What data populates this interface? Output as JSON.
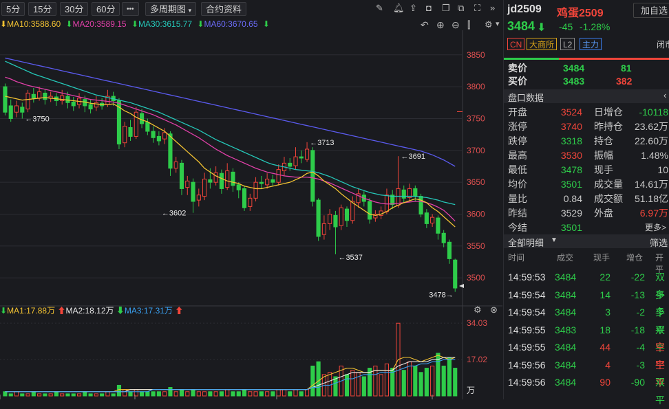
{
  "toolbar": {
    "periods": [
      "5分",
      "15分",
      "30分",
      "60分"
    ],
    "more": "•••",
    "multi_period": "多周期图",
    "contract_info": "合约资料"
  },
  "ma_line": {
    "ma10": "MA10:3588.60",
    "ma20": "MA20:3589.15",
    "ma30": "MA30:3615.77",
    "ma60": "MA60:3670.65"
  },
  "vol_line": {
    "ma1": "MA1:17.88万",
    "ma2": "MA2:18.12万",
    "ma3": "MA3:17.31万"
  },
  "colors": {
    "ma10": "#f2c232",
    "ma20": "#e040a8",
    "ma30": "#25c7b8",
    "ma60": "#5b5bf0",
    "up": "#f0453a",
    "down": "#2ecc4a"
  },
  "chart_data": {
    "type": "candlestick",
    "ylim": [
      3470,
      3880
    ],
    "y_ticks": [
      3850,
      3800,
      3750,
      3700,
      3650,
      3600,
      3550,
      3500
    ],
    "annotations": [
      {
        "label": "3750",
        "index": 3,
        "value": 3750
      },
      {
        "label": "3602",
        "index": 27,
        "value": 3602
      },
      {
        "label": "3713",
        "index": 53,
        "value": 3713
      },
      {
        "label": "3537",
        "index": 58,
        "value": 3537
      },
      {
        "label": "3691",
        "index": 69,
        "value": 3691
      },
      {
        "label": "3478",
        "index": 79,
        "value": 3478
      }
    ],
    "candles": [
      [
        3800,
        3760,
        3805,
        3755
      ],
      [
        3770,
        3750,
        3780,
        3745
      ],
      [
        3760,
        3770,
        3778,
        3752
      ],
      [
        3768,
        3760,
        3775,
        3750
      ],
      [
        3765,
        3790,
        3795,
        3760
      ],
      [
        3788,
        3782,
        3798,
        3775
      ],
      [
        3782,
        3792,
        3800,
        3778
      ],
      [
        3790,
        3780,
        3796,
        3772
      ],
      [
        3782,
        3785,
        3792,
        3776
      ],
      [
        3784,
        3778,
        3790,
        3770
      ],
      [
        3778,
        3786,
        3795,
        3772
      ],
      [
        3785,
        3775,
        3792,
        3766
      ],
      [
        3776,
        3770,
        3784,
        3762
      ],
      [
        3772,
        3782,
        3790,
        3766
      ],
      [
        3780,
        3770,
        3786,
        3760
      ],
      [
        3772,
        3765,
        3780,
        3758
      ],
      [
        3768,
        3775,
        3785,
        3762
      ],
      [
        3774,
        3770,
        3782,
        3764
      ],
      [
        3772,
        3785,
        3795,
        3768
      ],
      [
        3785,
        3778,
        3792,
        3770
      ],
      [
        3778,
        3710,
        3782,
        3702
      ],
      [
        3712,
        3738,
        3745,
        3705
      ],
      [
        3736,
        3722,
        3748,
        3715
      ],
      [
        3722,
        3760,
        3768,
        3718
      ],
      [
        3758,
        3742,
        3765,
        3735
      ],
      [
        3744,
        3730,
        3750,
        3724
      ],
      [
        3730,
        3720,
        3738,
        3712
      ],
      [
        3722,
        3715,
        3730,
        3708
      ],
      [
        3718,
        3728,
        3735,
        3710
      ],
      [
        3726,
        3672,
        3730,
        3660
      ],
      [
        3672,
        3682,
        3690,
        3665
      ],
      [
        3680,
        3640,
        3685,
        3630
      ],
      [
        3642,
        3652,
        3660,
        3630
      ],
      [
        3650,
        3620,
        3656,
        3602
      ],
      [
        3622,
        3630,
        3640,
        3612
      ],
      [
        3628,
        3655,
        3665,
        3622
      ],
      [
        3654,
        3650,
        3672,
        3640
      ],
      [
        3650,
        3665,
        3675,
        3645
      ],
      [
        3664,
        3640,
        3670,
        3632
      ],
      [
        3642,
        3668,
        3680,
        3638
      ],
      [
        3666,
        3645,
        3672,
        3635
      ],
      [
        3646,
        3638,
        3650,
        3625
      ],
      [
        3640,
        3610,
        3645,
        3605
      ],
      [
        3612,
        3625,
        3632,
        3605
      ],
      [
        3625,
        3650,
        3658,
        3620
      ],
      [
        3650,
        3648,
        3660,
        3640
      ],
      [
        3646,
        3655,
        3664,
        3640
      ],
      [
        3654,
        3650,
        3662,
        3644
      ],
      [
        3650,
        3670,
        3678,
        3645
      ],
      [
        3668,
        3680,
        3690,
        3660
      ],
      [
        3680,
        3675,
        3688,
        3668
      ],
      [
        3676,
        3690,
        3705,
        3670
      ],
      [
        3690,
        3688,
        3700,
        3680
      ],
      [
        3686,
        3702,
        3713,
        3682
      ],
      [
        3700,
        3620,
        3705,
        3612
      ],
      [
        3622,
        3565,
        3625,
        3558
      ],
      [
        3568,
        3585,
        3598,
        3560
      ],
      [
        3585,
        3600,
        3608,
        3575
      ],
      [
        3598,
        3580,
        3605,
        3537
      ],
      [
        3582,
        3610,
        3615,
        3575
      ],
      [
        3608,
        3590,
        3612,
        3580
      ],
      [
        3590,
        3620,
        3628,
        3585
      ],
      [
        3618,
        3632,
        3640,
        3610
      ],
      [
        3630,
        3620,
        3636,
        3612
      ],
      [
        3620,
        3592,
        3625,
        3585
      ],
      [
        3594,
        3600,
        3606,
        3588
      ],
      [
        3598,
        3605,
        3612,
        3592
      ],
      [
        3604,
        3630,
        3640,
        3600
      ],
      [
        3630,
        3615,
        3638,
        3608
      ],
      [
        3614,
        3640,
        3691,
        3610
      ],
      [
        3638,
        3625,
        3645,
        3618
      ],
      [
        3626,
        3640,
        3648,
        3620
      ],
      [
        3640,
        3628,
        3645,
        3620
      ],
      [
        3628,
        3600,
        3632,
        3595
      ],
      [
        3602,
        3585,
        3608,
        3578
      ],
      [
        3586,
        3595,
        3600,
        3580
      ],
      [
        3594,
        3570,
        3598,
        3560
      ],
      [
        3570,
        3555,
        3575,
        3548
      ],
      [
        3556,
        3530,
        3560,
        3522
      ],
      [
        3528,
        3484,
        3530,
        3478
      ]
    ],
    "ma10": [
      3785,
      3783,
      3781,
      3779,
      3780,
      3781,
      3782,
      3783,
      3782,
      3781,
      3780,
      3779,
      3778,
      3777,
      3776,
      3774,
      3773,
      3772,
      3772,
      3773,
      3768,
      3762,
      3758,
      3752,
      3748,
      3745,
      3740,
      3735,
      3730,
      3722,
      3714,
      3706,
      3698,
      3690,
      3682,
      3672,
      3666,
      3660,
      3656,
      3652,
      3650,
      3648,
      3644,
      3642,
      3640,
      3640,
      3642,
      3644,
      3646,
      3648,
      3650,
      3654,
      3658,
      3664,
      3666,
      3660,
      3652,
      3646,
      3640,
      3632,
      3625,
      3618,
      3612,
      3606,
      3600,
      3598,
      3600,
      3604,
      3610,
      3614,
      3618,
      3621,
      3624,
      3622,
      3618,
      3610,
      3604,
      3596,
      3588,
      3580
    ],
    "ma20": [
      3815,
      3812,
      3808,
      3805,
      3802,
      3800,
      3798,
      3796,
      3794,
      3792,
      3790,
      3788,
      3786,
      3784,
      3782,
      3780,
      3779,
      3778,
      3777,
      3776,
      3774,
      3771,
      3768,
      3765,
      3762,
      3759,
      3756,
      3752,
      3748,
      3744,
      3740,
      3735,
      3730,
      3725,
      3720,
      3714,
      3708,
      3702,
      3697,
      3692,
      3688,
      3684,
      3680,
      3676,
      3672,
      3669,
      3666,
      3664,
      3662,
      3660,
      3659,
      3658,
      3658,
      3658,
      3657,
      3655,
      3652,
      3649,
      3645,
      3641,
      3637,
      3633,
      3629,
      3625,
      3622,
      3619,
      3617,
      3616,
      3616,
      3617,
      3618,
      3619,
      3620,
      3620,
      3618,
      3615,
      3611,
      3606,
      3598,
      3589
    ],
    "ma30": [
      3840,
      3836,
      3832,
      3828,
      3824,
      3820,
      3817,
      3814,
      3811,
      3808,
      3805,
      3802,
      3799,
      3796,
      3793,
      3790,
      3787,
      3785,
      3783,
      3781,
      3779,
      3777,
      3775,
      3772,
      3769,
      3766,
      3763,
      3760,
      3756,
      3752,
      3748,
      3744,
      3740,
      3736,
      3732,
      3727,
      3722,
      3717,
      3713,
      3709,
      3705,
      3701,
      3697,
      3693,
      3689,
      3685,
      3681,
      3678,
      3676,
      3674,
      3672,
      3670,
      3669,
      3668,
      3667,
      3665,
      3662,
      3659,
      3655,
      3651,
      3647,
      3643,
      3640,
      3637,
      3634,
      3632,
      3630,
      3629,
      3628,
      3628,
      3628,
      3628,
      3628,
      3627,
      3626,
      3624,
      3622,
      3619,
      3617,
      3615
    ],
    "ma60": [
      3845,
      3843,
      3841,
      3839,
      3837,
      3835,
      3833,
      3831,
      3829,
      3827,
      3825,
      3823,
      3821,
      3819,
      3817,
      3815,
      3813,
      3811,
      3809,
      3807,
      3805,
      3803,
      3801,
      3799,
      3797,
      3795,
      3793,
      3791,
      3789,
      3787,
      3785,
      3783,
      3781,
      3779,
      3777,
      3775,
      3773,
      3771,
      3769,
      3767,
      3765,
      3763,
      3761,
      3759,
      3757,
      3755,
      3753,
      3751,
      3749,
      3747,
      3745,
      3743,
      3741,
      3739,
      3737,
      3735,
      3733,
      3731,
      3729,
      3727,
      3725,
      3723,
      3721,
      3719,
      3717,
      3715,
      3713,
      3711,
      3709,
      3707,
      3705,
      3703,
      3701,
      3699,
      3696,
      3693,
      3689,
      3685,
      3680,
      3675
    ],
    "volume": {
      "ylim": [
        0,
        36
      ],
      "y_ticks": [
        "34.03",
        "17.02"
      ],
      "unit": "万",
      "values": [
        2,
        1,
        2,
        1,
        1,
        2,
        1,
        1,
        1,
        2,
        1,
        1,
        1,
        1,
        2,
        1,
        1,
        1,
        2,
        1,
        5,
        3,
        2,
        3,
        2,
        2,
        2,
        2,
        2,
        4,
        2,
        3,
        2,
        3,
        2,
        2,
        2,
        2,
        2,
        3,
        2,
        2,
        3,
        2,
        2,
        2,
        2,
        2,
        3,
        3,
        2,
        3,
        2,
        3,
        14,
        16,
        10,
        11,
        9,
        14,
        10,
        12,
        11,
        9,
        13,
        14,
        10,
        15,
        13,
        34,
        12,
        16,
        14,
        11,
        13,
        14,
        20,
        14,
        18,
        13
      ],
      "ma1": [
        2,
        2,
        2,
        2,
        2,
        2,
        2,
        2,
        2,
        2,
        2,
        2,
        2,
        2,
        2,
        2,
        2,
        2,
        2,
        2,
        3,
        3,
        3,
        3,
        3,
        3,
        3,
        3,
        3,
        3,
        3,
        3,
        3,
        3,
        3,
        3,
        3,
        3,
        3,
        3,
        3,
        3,
        3,
        3,
        3,
        3,
        3,
        3,
        3,
        3,
        3,
        3,
        3,
        3,
        5,
        7,
        9,
        10,
        11,
        12,
        13,
        13,
        12,
        11,
        11,
        12,
        12,
        12,
        12,
        17,
        18,
        18,
        17,
        16,
        17,
        18,
        19,
        18,
        17,
        18
      ],
      "ma2": [
        2,
        2,
        2,
        2,
        2,
        2,
        2,
        2,
        2,
        2,
        2,
        2,
        2,
        2,
        2,
        2,
        2,
        2,
        2,
        2,
        2,
        2,
        3,
        3,
        3,
        3,
        3,
        3,
        3,
        3,
        3,
        3,
        3,
        3,
        3,
        3,
        3,
        3,
        3,
        3,
        3,
        3,
        3,
        3,
        3,
        3,
        3,
        3,
        3,
        3,
        3,
        3,
        3,
        3,
        4,
        5,
        6,
        7,
        8,
        9,
        10,
        11,
        11,
        11,
        11,
        12,
        12,
        12,
        12,
        14,
        15,
        16,
        16,
        16,
        16,
        17,
        17,
        18,
        18,
        18
      ],
      "ma3": [
        2,
        2,
        2,
        2,
        2,
        2,
        2,
        2,
        2,
        2,
        2,
        2,
        2,
        2,
        2,
        2,
        2,
        2,
        2,
        2,
        2,
        2,
        2,
        2,
        2,
        2,
        3,
        3,
        3,
        3,
        3,
        3,
        3,
        3,
        3,
        3,
        3,
        3,
        3,
        3,
        3,
        3,
        3,
        3,
        3,
        3,
        3,
        3,
        3,
        3,
        3,
        3,
        3,
        3,
        4,
        4,
        5,
        5,
        6,
        7,
        8,
        8,
        9,
        10,
        10,
        10,
        11,
        11,
        11,
        12,
        13,
        14,
        14,
        15,
        15,
        16,
        16,
        17,
        17,
        17
      ]
    }
  },
  "quote": {
    "code": "jd2509",
    "name": "鸡蛋2509",
    "add_button": "加自选",
    "price": "3484",
    "change": "-45",
    "change_pct": "-1.28%",
    "badges": [
      "CN",
      "大商所",
      "L2",
      "主力"
    ],
    "status": "闭市",
    "ask_label": "卖价",
    "ask_price": "3484",
    "ask_vol": "81",
    "bid_label": "买价",
    "bid_price": "3483",
    "bid_vol": "382",
    "panel_title": "盘口数据",
    "stats": [
      {
        "l1": "开盘",
        "v1": "3524",
        "c1": "red",
        "l2": "日增仓",
        "v2": "-10118",
        "c2": "grn"
      },
      {
        "l1": "涨停",
        "v1": "3740",
        "c1": "red",
        "l2": "昨持仓",
        "v2": "23.62万",
        "c2": "gry"
      },
      {
        "l1": "跌停",
        "v1": "3318",
        "c1": "grn",
        "l2": "持仓",
        "v2": "22.60万",
        "c2": "gry"
      },
      {
        "l1": "最高",
        "v1": "3530",
        "c1": "red",
        "l2": "振幅",
        "v2": "1.48%",
        "c2": "gry"
      },
      {
        "l1": "最低",
        "v1": "3478",
        "c1": "grn",
        "l2": "现手",
        "v2": "10",
        "c2": "gry"
      },
      {
        "l1": "均价",
        "v1": "3501",
        "c1": "grn",
        "l2": "成交量",
        "v2": "14.61万",
        "c2": "gry"
      },
      {
        "l1": "量比",
        "v1": "0.84",
        "c1": "gry",
        "l2": "成交额",
        "v2": "51.18亿",
        "c2": "gry"
      },
      {
        "l1": "昨结",
        "v1": "3529",
        "c1": "gry",
        "l2": "外盘",
        "v2": "6.97万",
        "c2": "red"
      },
      {
        "l1": "今结",
        "v1": "3501",
        "c1": "grn",
        "l2": "更多>",
        "v2": "",
        "c2": "gry"
      }
    ],
    "detail_title": "全部明细",
    "filter": "筛选",
    "trade_headers": [
      "时间",
      "成交",
      "现手",
      "增仓",
      "开平"
    ],
    "trades": [
      {
        "t": "14:59:53",
        "p": "3484",
        "v": "22",
        "vc": "grn",
        "d": "-22",
        "k": "双平",
        "kc": "grn"
      },
      {
        "t": "14:59:54",
        "p": "3484",
        "v": "14",
        "vc": "grn",
        "d": "-13",
        "k": "多平",
        "kc": "grn"
      },
      {
        "t": "14:59:54",
        "p": "3484",
        "v": "3",
        "vc": "grn",
        "d": "-2",
        "k": "多平",
        "kc": "grn"
      },
      {
        "t": "14:59:55",
        "p": "3483",
        "v": "18",
        "vc": "grn",
        "d": "-18",
        "k": "双平",
        "kc": "grn"
      },
      {
        "t": "14:59:55",
        "p": "3484",
        "v": "44",
        "vc": "red",
        "d": "-4",
        "k": "空平",
        "kc": "red"
      },
      {
        "t": "14:59:56",
        "p": "3484",
        "v": "4",
        "vc": "red",
        "d": "-3",
        "k": "空平",
        "kc": "red"
      },
      {
        "t": "14:59:56",
        "p": "3484",
        "v": "90",
        "vc": "red",
        "d": "-90",
        "k": "双平",
        "kc": "grn"
      }
    ]
  }
}
